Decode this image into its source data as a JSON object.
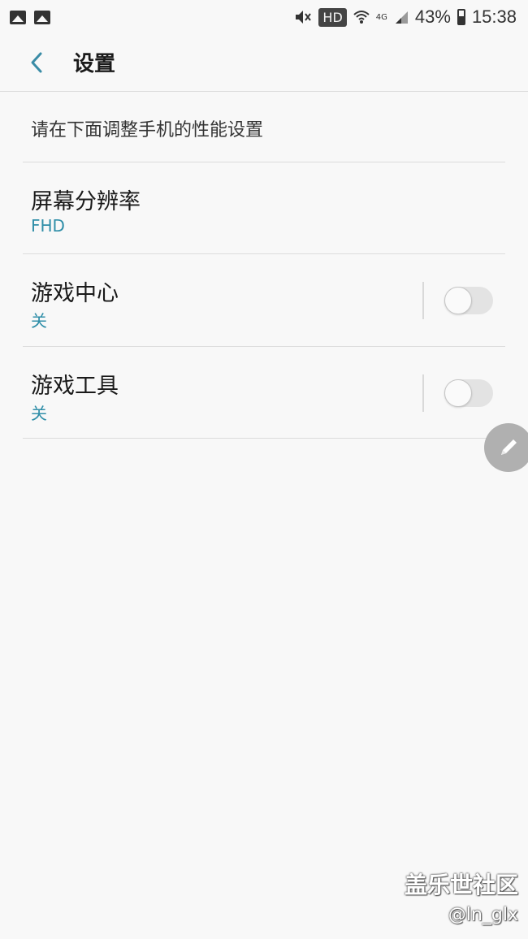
{
  "status_bar": {
    "hd": "HD",
    "network": "4G",
    "battery": "43%",
    "time": "15:38",
    "icons": [
      "gallery-icon",
      "gallery-icon",
      "mute-icon",
      "wifi-icon",
      "signal-icon",
      "battery-icon"
    ]
  },
  "header": {
    "title": "设置",
    "back_icon": "chevron-left-icon"
  },
  "description": "请在下面调整手机的性能设置",
  "items": [
    {
      "title": "屏幕分辨率",
      "subtitle": "FHD"
    },
    {
      "title": "游戏中心",
      "subtitle": "关",
      "toggle_on": false
    },
    {
      "title": "游戏工具",
      "subtitle": "关",
      "toggle_on": false
    }
  ],
  "floating_button": {
    "icon": "pencil-icon"
  },
  "watermark": {
    "site": "盖乐世社区",
    "user": "@ln_glx"
  },
  "colors": {
    "accent": "#2f8ea8",
    "background": "#f8f8f8"
  }
}
